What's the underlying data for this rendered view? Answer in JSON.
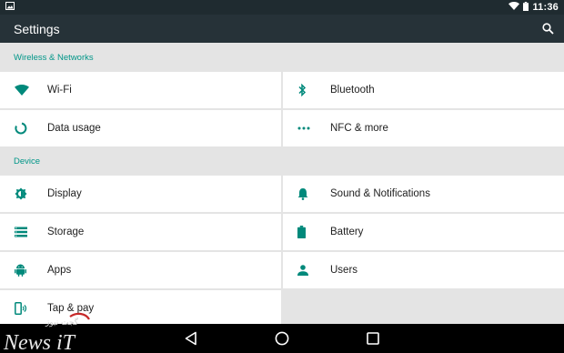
{
  "status": {
    "time": "11:36"
  },
  "toolbar": {
    "title": "Settings"
  },
  "sections": [
    {
      "header": "Wireless & Networks",
      "items": [
        {
          "label": "Wi-Fi",
          "icon": "wifi-icon"
        },
        {
          "label": "Bluetooth",
          "icon": "bluetooth-icon"
        },
        {
          "label": "Data usage",
          "icon": "data-usage-icon"
        },
        {
          "label": "NFC & more",
          "icon": "more-dots-icon"
        }
      ]
    },
    {
      "header": "Device",
      "items": [
        {
          "label": "Display",
          "icon": "brightness-icon"
        },
        {
          "label": "Sound & Notifications",
          "icon": "bell-icon"
        },
        {
          "label": "Storage",
          "icon": "storage-icon"
        },
        {
          "label": "Battery",
          "icon": "battery-icon"
        },
        {
          "label": "Apps",
          "icon": "android-icon"
        },
        {
          "label": "Users",
          "icon": "person-icon"
        },
        {
          "label": "Tap & pay",
          "icon": "tap-pay-icon"
        }
      ]
    }
  ],
  "watermark": {
    "text": "News iT",
    "logo_text": "گجت نیوز"
  },
  "colors": {
    "accent": "#009688",
    "actionbar": "#263238",
    "statusbar": "#1f2b30",
    "icon": "#00897b"
  }
}
